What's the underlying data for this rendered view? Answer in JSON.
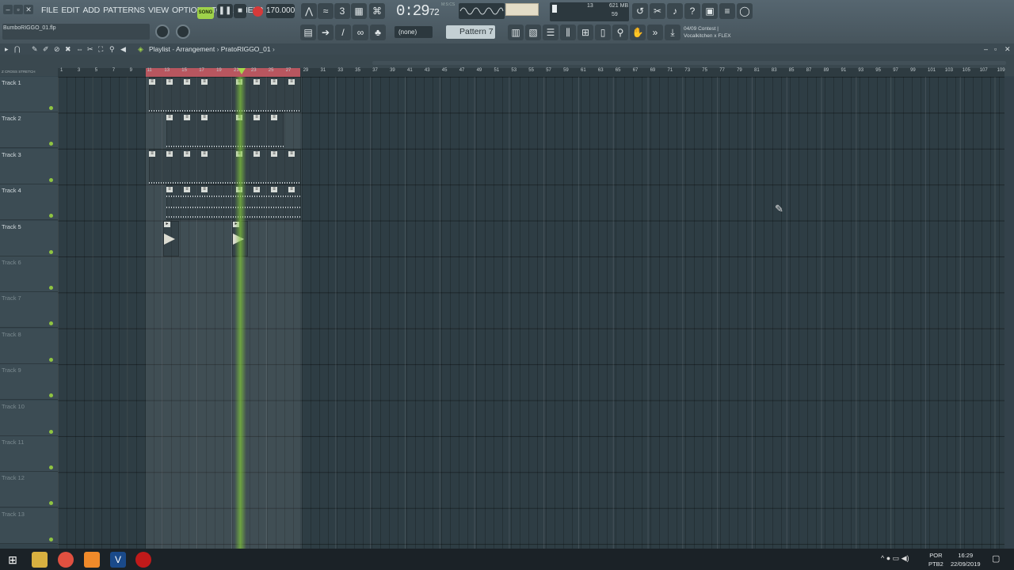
{
  "menu": [
    "FILE",
    "EDIT",
    "ADD",
    "PATTERNS",
    "VIEW",
    "OPTIONS",
    "TOOLS",
    "HELP"
  ],
  "transport": {
    "song_label": "SONG",
    "tempo": "170.000",
    "time_main": "0:29",
    "time_sub": "72",
    "time_mode": "M:S:CS"
  },
  "cpu": {
    "ram": "621 MB",
    "voices": "13",
    "poly": "59"
  },
  "file_name": "BumboRIGGO_01.flp",
  "channel_select": "(none)",
  "pattern": "Pattern 7",
  "hint": {
    "line1": "04/09  Contest |",
    "line2": "Vocalkitchen x FLEX"
  },
  "playlist": {
    "title": "Playlist",
    "crumb1": "Arrangement",
    "crumb2": "PratoRIGGO_01",
    "tool_labels": [
      "Z CROSS",
      "STRETCH"
    ]
  },
  "ruler": [
    "1",
    "3",
    "5",
    "7",
    "9",
    "11",
    "13",
    "15",
    "17",
    "19",
    "21",
    "23",
    "25",
    "27",
    "29",
    "31",
    "33",
    "35",
    "37",
    "39",
    "41",
    "43",
    "45",
    "47",
    "49",
    "51",
    "53",
    "55",
    "57",
    "59",
    "61",
    "63",
    "65",
    "67",
    "69",
    "71",
    "73",
    "75",
    "77",
    "79",
    "81",
    "83",
    "85",
    "87",
    "89",
    "91",
    "93",
    "95",
    "97",
    "99",
    "101",
    "103",
    "105",
    "107",
    "109"
  ],
  "tracks": [
    "Track 1",
    "Track 2",
    "Track 3",
    "Track 4",
    "Track 5",
    "Track 6",
    "Track 7",
    "Track 8",
    "Track 9",
    "Track 10",
    "Track 11",
    "Track 12",
    "Track 13"
  ],
  "taskbar": {
    "lang1": "POR",
    "lang2": "PTB2",
    "time": "16:29",
    "date": "22/09/2019"
  },
  "colors": {
    "song_accent": "#9fd24a",
    "loop": "#c85a63",
    "playhead": "#8cc83c",
    "grid_bg": "#2e3d44"
  }
}
